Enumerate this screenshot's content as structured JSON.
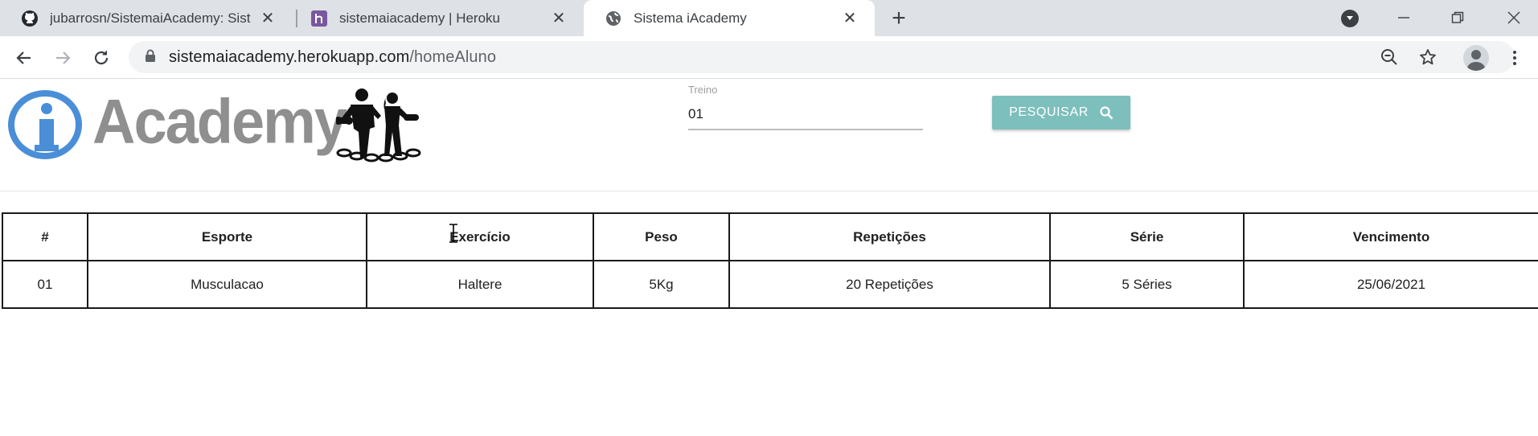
{
  "browser": {
    "tabs": [
      {
        "title": "jubarrosn/SistemaiAcademy: Sist",
        "icon": "github-icon",
        "active": false
      },
      {
        "title": "sistemaiacademy | Heroku",
        "icon": "heroku-icon",
        "active": false
      },
      {
        "title": "Sistema iAcademy",
        "icon": "globe-icon",
        "active": true
      }
    ],
    "new_tab_icon": "plus-icon",
    "url_host": "sistemaiacademy.herokuapp.com",
    "url_path": "/homeAluno",
    "toolbar_icons": [
      "back-icon",
      "forward-icon",
      "reload-icon",
      "lock-icon",
      "zoom-out-icon",
      "star-icon",
      "profile-icon",
      "menu-icon"
    ],
    "window_controls": [
      "minimize-icon",
      "restore-icon",
      "close-icon"
    ]
  },
  "page": {
    "logo_text": "Academy",
    "logo_colors": {
      "circle": "#4a8ed8",
      "text": "#8f8f8f"
    },
    "search": {
      "label": "Treino",
      "value": "01",
      "button_label": "PESQUISAR",
      "button_color": "#7dbfbd"
    },
    "table": {
      "headers": [
        "#",
        "Esporte",
        "Exercício",
        "Peso",
        "Repetições",
        "Série",
        "Vencimento"
      ],
      "rows": [
        [
          "01",
          "Musculacao",
          "Haltere",
          "5Kg",
          "20 Repetições",
          "5 Séries",
          "25/06/2021"
        ]
      ]
    }
  }
}
